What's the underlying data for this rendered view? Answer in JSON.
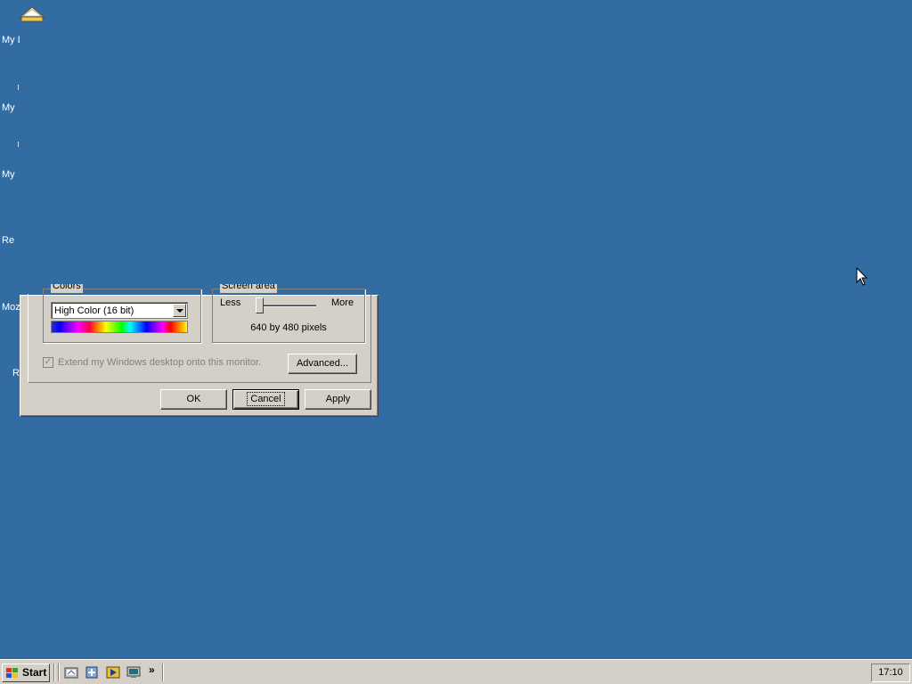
{
  "desktop": {
    "icon_labels": [
      "My D",
      "My",
      "My",
      "Re",
      "Moz",
      "R"
    ]
  },
  "dialog": {
    "colors_group_label": "Colors",
    "colors_select_value": "High Color (16 bit)",
    "screen_area_group_label": "Screen area",
    "slider_less_label": "Less",
    "slider_more_label": "More",
    "resolution_text": "640 by 480 pixels",
    "extend_checkbox_label": "Extend my Windows desktop onto this monitor.",
    "advanced_button": "Advanced...",
    "ok_button": "OK",
    "cancel_button": "Cancel",
    "apply_button": "Apply"
  },
  "taskbar": {
    "start_label": "Start",
    "quick_launch": [
      "show-desktop-icon",
      "internet-explorer-icon",
      "media-player-icon",
      "desktop-icon"
    ],
    "more_label": "»",
    "clock": "17:10"
  },
  "colors": {
    "desktop": "#336ba3",
    "dialog": "#d4d0c8"
  }
}
